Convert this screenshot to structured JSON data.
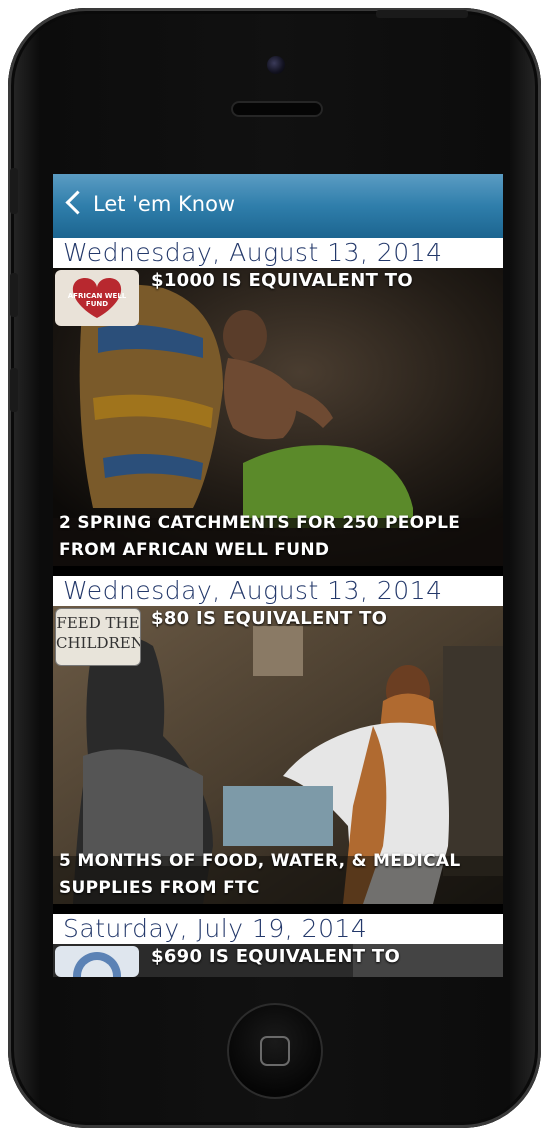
{
  "navbar": {
    "back_label": "Let 'em Know"
  },
  "feed": [
    {
      "date": "Wednesday, August 13, 2014",
      "headline": "$1000 IS EQUIVALENT TO",
      "caption_line1": "2 SPRING CATCHMENTS FOR 250 PEOPLE",
      "caption_line2": "FROM AFRICAN WELL FUND",
      "logo_text": "AFRICAN WELL FUND"
    },
    {
      "date": "Wednesday, August 13, 2014",
      "headline": "$80 IS EQUIVALENT TO",
      "caption_line1": "5 MONTHS OF FOOD, WATER, & MEDICAL",
      "caption_line2": "SUPPLIES FROM FTC",
      "logo_text_line1": "FEED THE",
      "logo_text_line2": "CHILDREN"
    },
    {
      "date": "Saturday, July 19, 2014",
      "headline": "$690 IS EQUIVALENT TO"
    }
  ],
  "colors": {
    "nav_top": "#5b9cc3",
    "nav_bottom": "#1c6590",
    "date_text": "#23386a",
    "caption_text": "#ffffff"
  },
  "icons": {
    "back": "chevron-left-icon",
    "home": "home-button-icon"
  }
}
